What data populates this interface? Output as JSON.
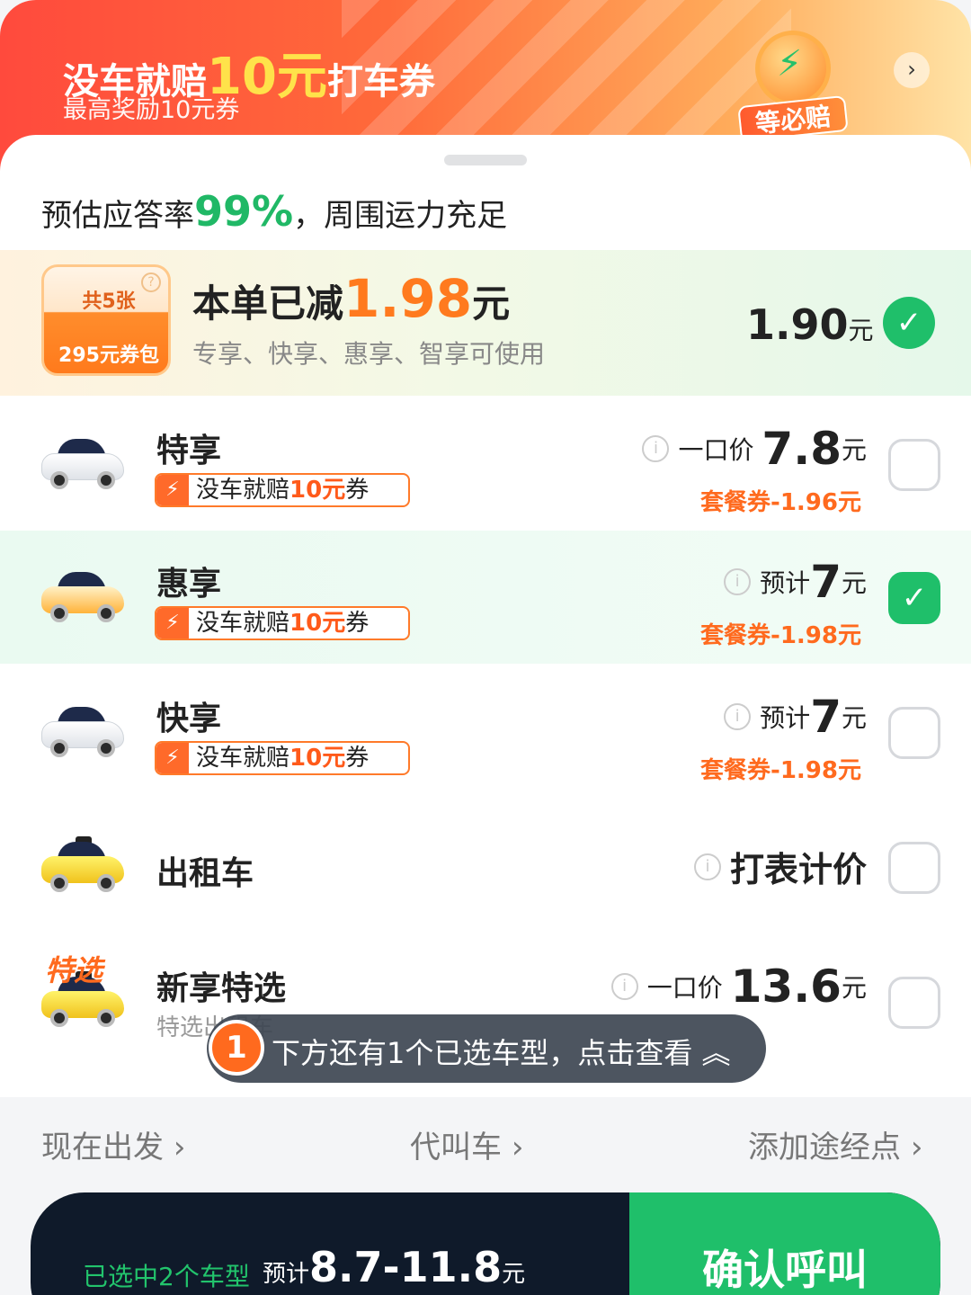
{
  "banner": {
    "title_pre": "没车就赔",
    "title_amount": "10元",
    "title_post": "打车券",
    "subtitle": "最高奖励10元券",
    "badge_label": "等必赔",
    "arrow_icon": "chevron-right-icon"
  },
  "sheet": {
    "rate_prefix": "预估应答率",
    "rate_value": "99%",
    "rate_suffix": "，周围运力充足"
  },
  "coupon": {
    "count_label": "共5张",
    "pack_label": "295元券包",
    "title_pre": "本单已减",
    "amount": "1.98",
    "title_unit": "元",
    "subtitle": "专享、快享、惠享、智享可使用",
    "price": "1.90",
    "price_unit": "元",
    "checked": true
  },
  "rides": [
    {
      "name": "特享",
      "badge_pre": "没车就赔",
      "badge_amt": "10元",
      "badge_post": "券",
      "price_label": "一口价",
      "price": "7.8",
      "unit": "元",
      "discount": "套餐券-1.96元",
      "checked": false
    },
    {
      "name": "惠享",
      "badge_pre": "没车就赔",
      "badge_amt": "10元",
      "badge_post": "券",
      "price_label": "预计",
      "price": "7",
      "unit": "元",
      "discount": "套餐券-1.98元",
      "checked": true
    },
    {
      "name": "快享",
      "badge_pre": "没车就赔",
      "badge_amt": "10元",
      "badge_post": "券",
      "price_label": "预计",
      "price": "7",
      "unit": "元",
      "discount": "套餐券-1.98元",
      "checked": false
    },
    {
      "name": "出租车",
      "price_label": "打表计价",
      "checked": false
    },
    {
      "name": "新享特选",
      "tag": "特选",
      "sub": "特选出租车",
      "price_label": "一口价",
      "price": "13.6",
      "unit": "元",
      "checked": false
    }
  ],
  "toast": {
    "number": "1",
    "text": "下方还有1个已选车型，点击查看",
    "icon": "double-chevron-up-icon"
  },
  "options": {
    "depart": "现在出发",
    "proxy": "代叫车",
    "waypoint": "添加途经点"
  },
  "bottom": {
    "selected": "已选中2个车型",
    "est_label": "预计",
    "range": "8.7-11.8",
    "unit": "元",
    "confirm": "确认呼叫"
  },
  "colors": {
    "accent_green": "#1fbf6a",
    "accent_orange": "#ff6a1e",
    "dark_bar": "#0f1a2a"
  }
}
